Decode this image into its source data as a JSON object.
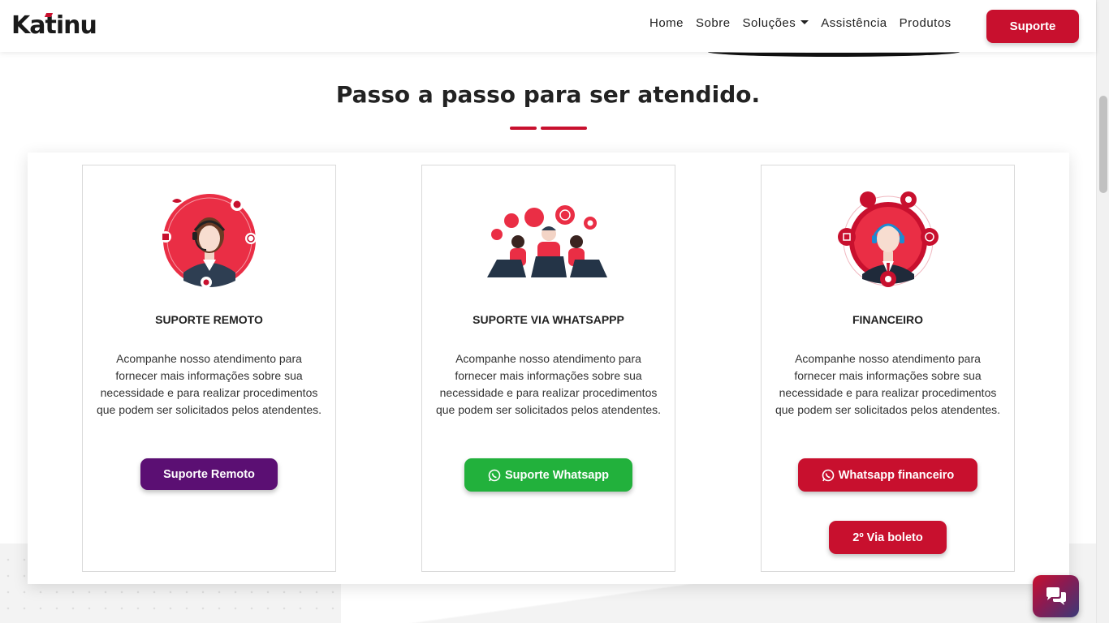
{
  "brand": {
    "logo_text": "Katinu",
    "accent_color": "#c8102e"
  },
  "nav": {
    "links": [
      "Home",
      "Sobre",
      "Soluções",
      "Assistência",
      "Produtos"
    ],
    "support_button": "Suporte"
  },
  "section": {
    "title": "Passo a passo para ser atendido."
  },
  "cards": [
    {
      "title": "SUPORTE REMOTO",
      "text": "Acompanhe nosso atendimento para fornecer mais informações sobre sua necessidade e para realizar procedimentos que podem ser solicitados pelos atendentes.",
      "buttons": [
        {
          "label": "Suporte Remoto",
          "color": "#5b0f73"
        }
      ],
      "illustration": "female-support-agent-icon"
    },
    {
      "title": "SUPORTE VIA WHATSAPPP",
      "text": "Acompanhe nosso atendimento para fornecer mais informações sobre sua necessidade e para realizar procedimentos que podem ser solicitados pelos atendentes.",
      "buttons": [
        {
          "label": "Suporte Whatsapp",
          "color": "#22b13c",
          "icon": "whatsapp-icon"
        }
      ],
      "illustration": "support-team-laptops-icon"
    },
    {
      "title": "FINANCEIRO",
      "text": "Acompanhe nosso atendimento para fornecer mais informações sobre sua necessidade e para realizar procedimentos que podem ser solicitados pelos atendentes.",
      "buttons": [
        {
          "label": "Whatsapp financeiro",
          "color": "#c8102e",
          "icon": "whatsapp-icon"
        },
        {
          "label": "2º Via boleto",
          "color": "#c8102e"
        }
      ],
      "illustration": "male-support-agent-icon"
    }
  ],
  "chat_widget": {
    "icon": "chat-bubbles-icon"
  }
}
